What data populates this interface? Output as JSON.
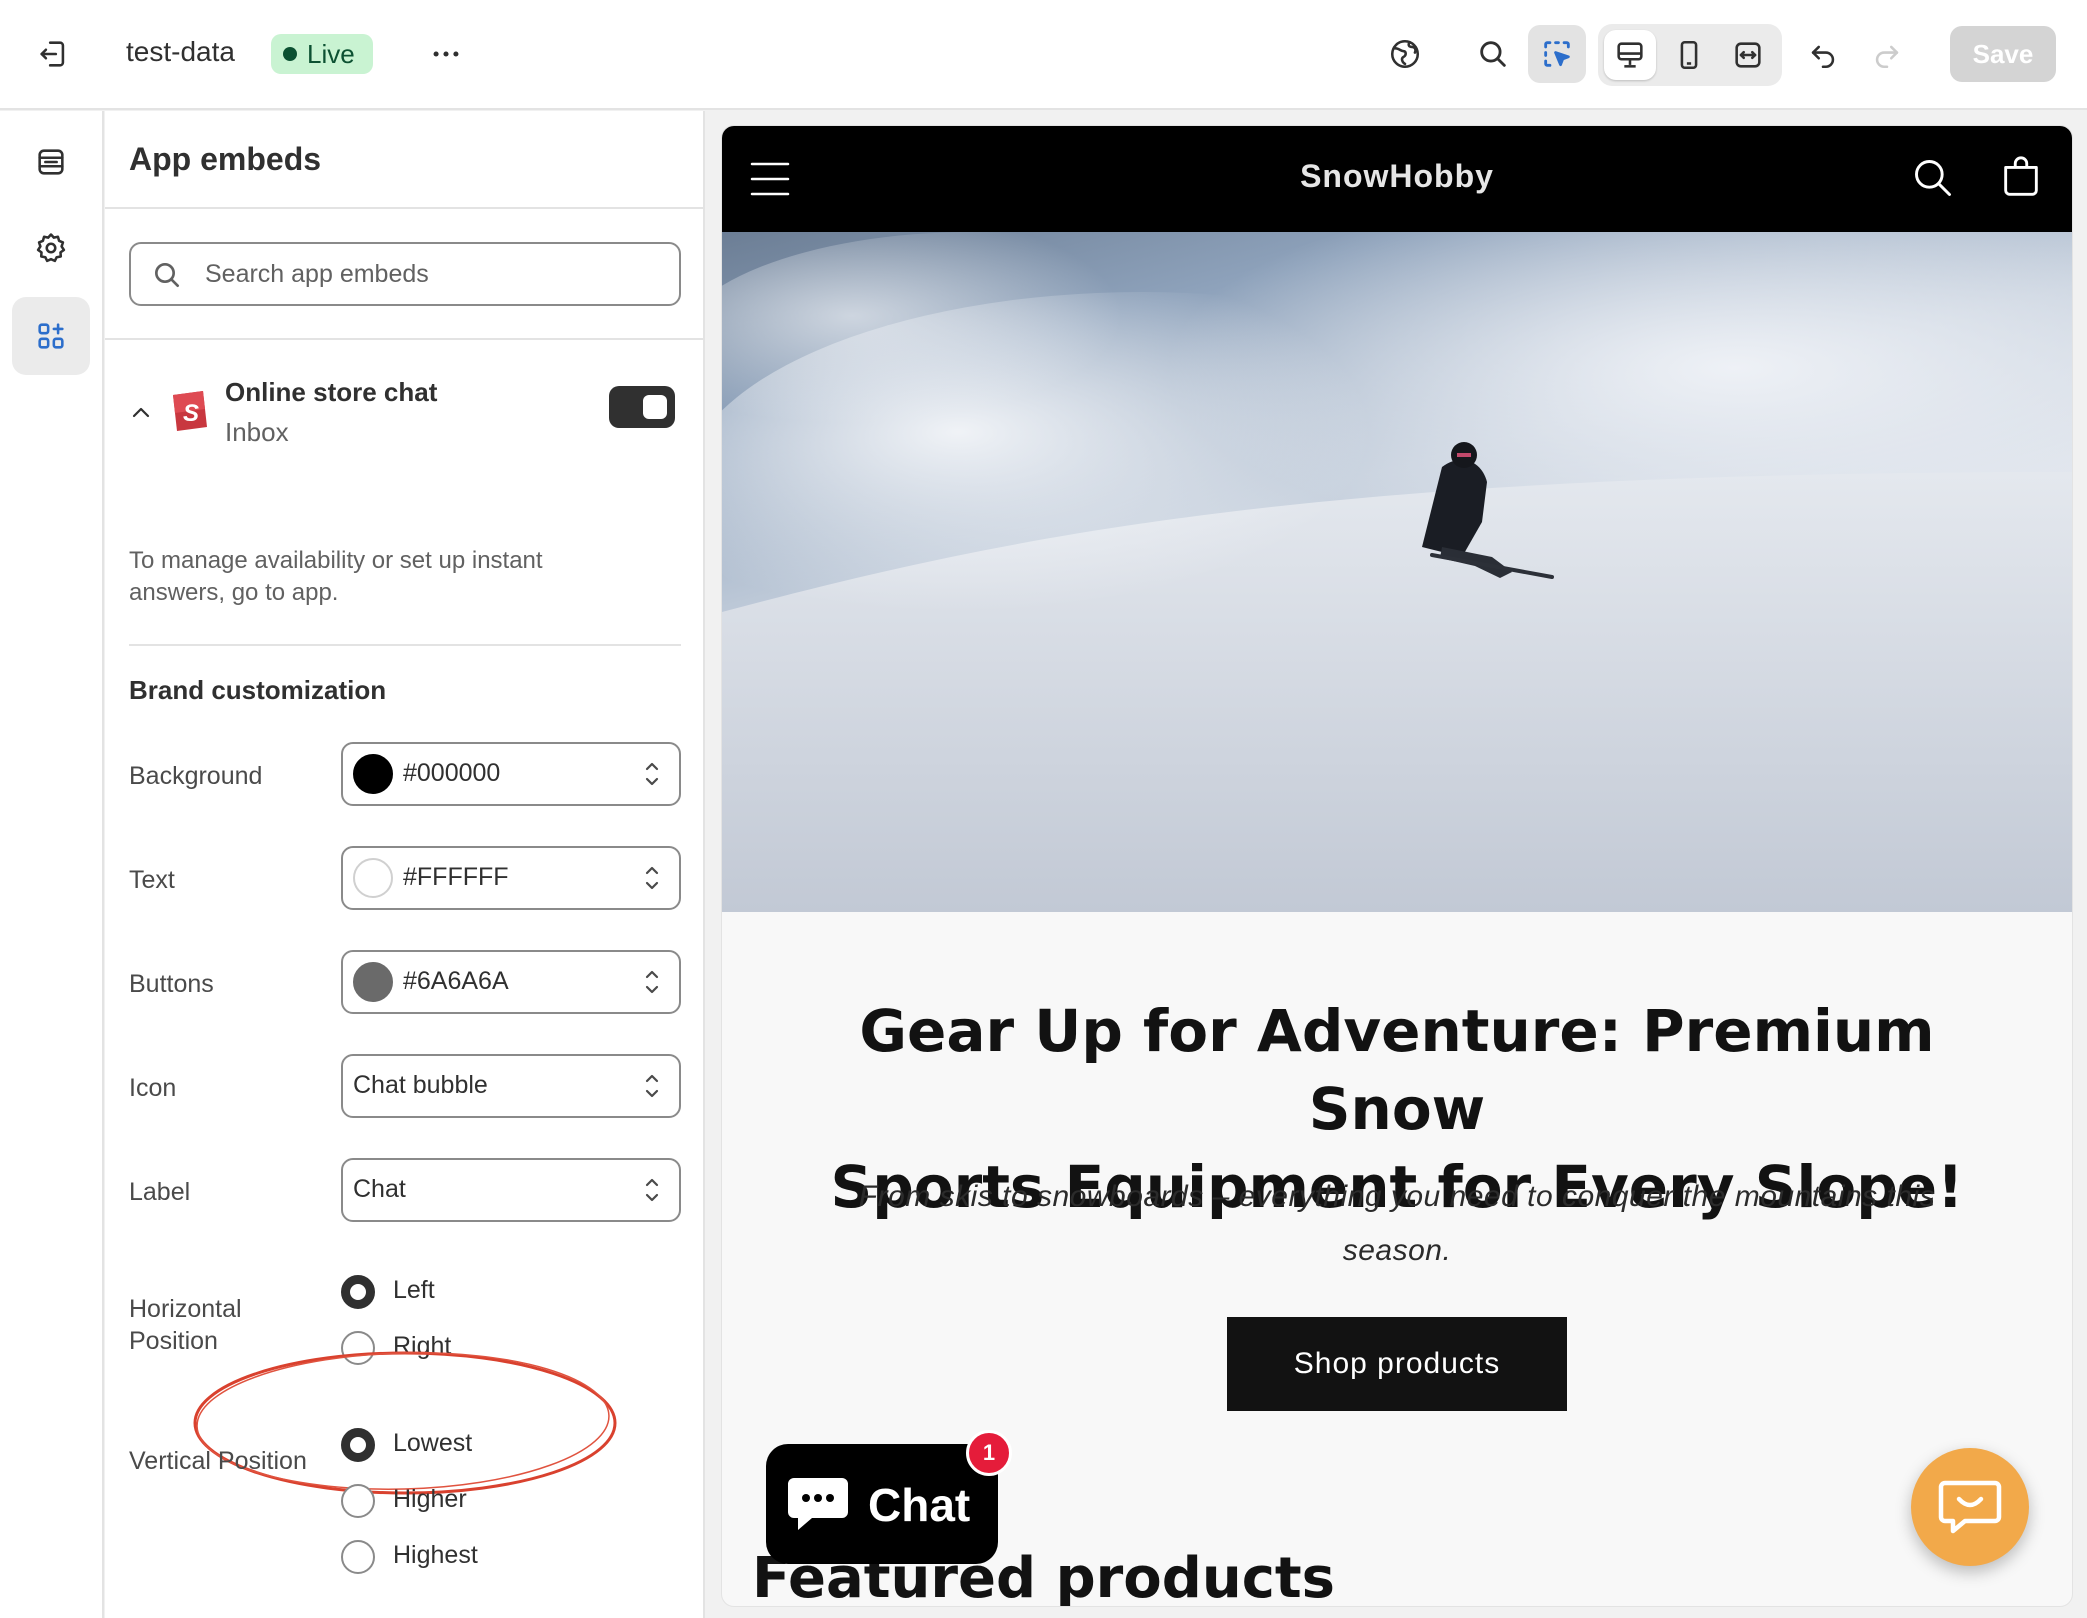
{
  "topbar": {
    "store_name": "test-data",
    "status_badge": "Live",
    "save_label": "Save"
  },
  "panel": {
    "title": "App embeds",
    "search": {
      "placeholder": "Search app embeds",
      "value": ""
    },
    "embed": {
      "name": "Online store chat",
      "subtitle": "Inbox",
      "enabled": true,
      "help_text": "To manage availability or set up instant answers, go to app."
    },
    "brand_section": "Brand customization",
    "fields": {
      "background": {
        "label": "Background",
        "value": "#000000",
        "swatch": "#000000"
      },
      "text": {
        "label": "Text",
        "value": "#FFFFFF",
        "swatch": "#FFFFFF"
      },
      "buttons": {
        "label": "Buttons",
        "value": "#6A6A6A",
        "swatch": "#6A6A6A"
      },
      "icon": {
        "label": "Icon",
        "value": "Chat bubble"
      },
      "label": {
        "label": "Label",
        "value": "Chat"
      }
    },
    "horizontal": {
      "label_line1": "Horizontal",
      "label_line2": "Position",
      "options": [
        "Left",
        "Right"
      ],
      "selected": "Left"
    },
    "vertical": {
      "label": "Vertical Position",
      "options": [
        "Lowest",
        "Higher",
        "Highest"
      ],
      "selected": "Lowest"
    }
  },
  "preview": {
    "brand": "SnowHobby",
    "headline_line1": "Gear Up for Adventure: Premium Snow",
    "headline_line2": "Sports Equipment for Every Slope!",
    "subline_line1": "From skis to snowboards – everything you need to conquer the mountains this",
    "subline_line2": "season.",
    "cta": "Shop products",
    "featured": "Featured products",
    "chat_label": "Chat",
    "chat_badge": "1",
    "fab_color": "#F2A94A"
  }
}
